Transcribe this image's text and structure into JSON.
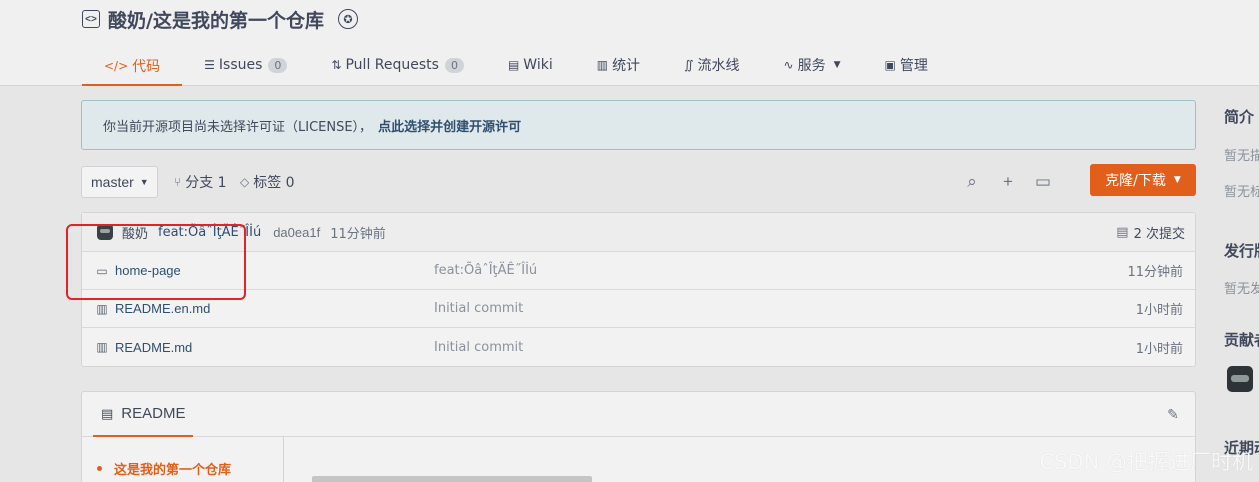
{
  "repo": {
    "title": "酸奶/这是我的第一个仓库"
  },
  "tabs": [
    {
      "label": "代码",
      "icon": "code-icon"
    },
    {
      "label": "Issues",
      "count": "0",
      "icon": "issues-icon"
    },
    {
      "label": "Pull Requests",
      "count": "0",
      "icon": "pull-request-icon"
    },
    {
      "label": "Wiki",
      "icon": "wiki-icon"
    },
    {
      "label": "统计",
      "icon": "stats-icon"
    },
    {
      "label": "流水线",
      "icon": "pipeline-icon"
    },
    {
      "label": "服务",
      "icon": "service-icon"
    },
    {
      "label": "管理",
      "icon": "manage-icon"
    }
  ],
  "notice": {
    "text": "你当前开源项目尚未选择许可证（LICENSE），",
    "link": "点此选择并创建开源许可"
  },
  "toolbar": {
    "branch": "master",
    "branches": "分支 1",
    "tags": "标签 0",
    "clone_label": "克隆/下载"
  },
  "last_commit": {
    "author": "酸奶",
    "message": "feat:ÕâˆÎţÄÊ˝Îİú",
    "hash": "da0ea1f",
    "time": "11分钟前",
    "count": "2 次提交"
  },
  "files": [
    {
      "name": "home-page",
      "type": "folder",
      "commit": "feat:ÕâˆÎţÄÊ˝Îİú",
      "time": "11分钟前"
    },
    {
      "name": "README.en.md",
      "type": "file",
      "commit": "Initial commit",
      "time": "1小时前"
    },
    {
      "name": "README.md",
      "type": "file",
      "commit": "Initial commit",
      "time": "1小时前"
    }
  ],
  "readme": {
    "tab_label": "README",
    "toc_item": "这是我的第一个仓库"
  },
  "right_panel": {
    "intro": "简介",
    "intro_text1": "暂无描",
    "intro_text2": "暂无标",
    "release": "发行版",
    "release_text": "暂无发",
    "contrib": "贡献者",
    "recent": "近期动"
  },
  "watermark": "CSDN @把握进厂时机",
  "colors": {
    "accent": "#e15f1a",
    "highlight": "#e0242b"
  }
}
